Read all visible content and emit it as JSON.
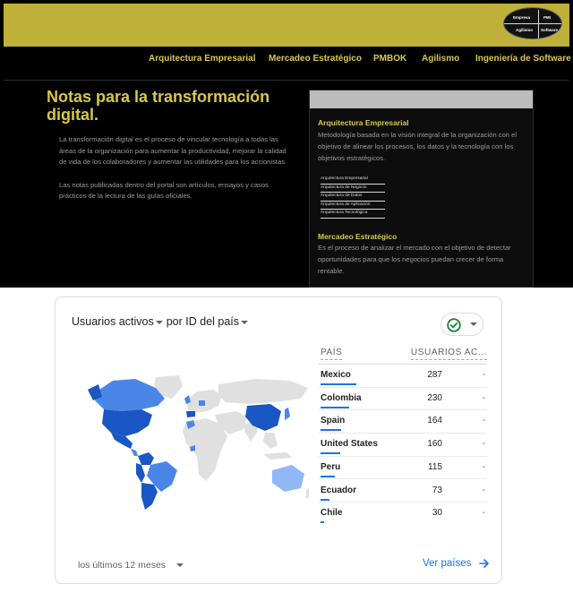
{
  "site": {
    "logo": {
      "tl": "Empresa",
      "tr": "PMI",
      "bl": "Agilismo",
      "br": "Software"
    },
    "nav": [
      "Arquitectura Empresarial",
      "Mercadeo Estratégico",
      "PMBOK",
      "Agilismo",
      "Ingeniería de Software"
    ],
    "hero": {
      "title": "Notas para la transformación digital.",
      "paragraphs": [
        "La transformación digital es el proceso de vincular tecnología a todas las áreas de la organización para aumentar la productividad, mejorar la calidad de vida de los colaboradores y aumentar las utilidades para los accionistas.",
        "Las notas publicadas dentro del portal son artículos, ensayos y casos prácticos de la lectura de las guías oficiales."
      ]
    },
    "panel": {
      "section1": {
        "heading": "Arquitectura Empresarial",
        "text": "Metodología basada en la visión integral de la organización con el objetivo de alinear los procesos, los datos y la tecnología con los objetivos estratégicos."
      },
      "list": [
        "Arquitectura Empresarial",
        "Arquitectura de Negocio",
        "Arquitectura de Datos",
        "Arquitectura de Aplicación",
        "Arquitectura Tecnológica"
      ],
      "section2": {
        "heading": "Mercadeo Estratégico",
        "text": "Es el proceso de analizar el mercado con el objetivo de detectar oportunidades para que los negocios puedan crecer de forma rentable."
      }
    }
  },
  "card": {
    "title_metric": "Usuarios activos",
    "title_by": "por",
    "title_dimension": "ID del país",
    "col_country": "PAÍS",
    "col_users": "USUARIOS AC...",
    "rows": [
      {
        "country": "Mexico",
        "users": "287",
        "delta": "-",
        "share": 1.0
      },
      {
        "country": "Colombia",
        "users": "230",
        "delta": "-",
        "share": 0.8
      },
      {
        "country": "Spain",
        "users": "164",
        "delta": "-",
        "share": 0.57
      },
      {
        "country": "United States",
        "users": "160",
        "delta": "-",
        "share": 0.56
      },
      {
        "country": "Peru",
        "users": "115",
        "delta": "-",
        "share": 0.4
      },
      {
        "country": "Ecuador",
        "users": "73",
        "delta": "-",
        "share": 0.25
      },
      {
        "country": "Chile",
        "users": "30",
        "delta": "-",
        "share": 0.1
      }
    ],
    "period": "los últimos 12 meses",
    "view_link": "Ver países",
    "icons": {
      "status": "check-circle-icon",
      "link": "arrow-right-icon"
    },
    "colors": {
      "dark": "#1a56c4",
      "mid": "#4a86e8",
      "light": "#8fb8f5",
      "none": "#e0e0e0",
      "accent": "#1a73e8",
      "check": "#188038"
    }
  }
}
